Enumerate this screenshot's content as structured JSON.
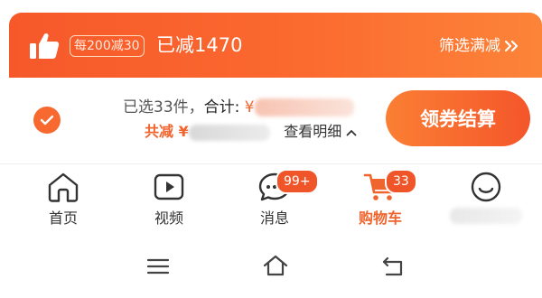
{
  "banner": {
    "promo_tag": "每200减30",
    "saved_text": "已减1470",
    "filter_label": "筛选满减"
  },
  "summary": {
    "selected_text": "已选33件，",
    "total_label": "合计: ",
    "currency": "¥",
    "discount_label": "共减 ",
    "view_detail": "查看明细",
    "checkout_label": "领券结算"
  },
  "nav": {
    "items": [
      {
        "label": "首页",
        "icon": "home-icon"
      },
      {
        "label": "视频",
        "icon": "video-play-icon"
      },
      {
        "label": "消息",
        "icon": "chat-bubble-icon",
        "badge": "99+"
      },
      {
        "label": "购物车",
        "icon": "shopping-cart-icon",
        "badge": "33",
        "active": true
      },
      {
        "label": "",
        "icon": "smiley-face-icon"
      }
    ]
  },
  "colors": {
    "brand_orange": "#f6582a",
    "banner_gradient_end": "#fc8439",
    "badge_red": "#f0552a"
  },
  "system_nav": [
    "menu-icon",
    "home-outline-icon",
    "back-icon"
  ]
}
